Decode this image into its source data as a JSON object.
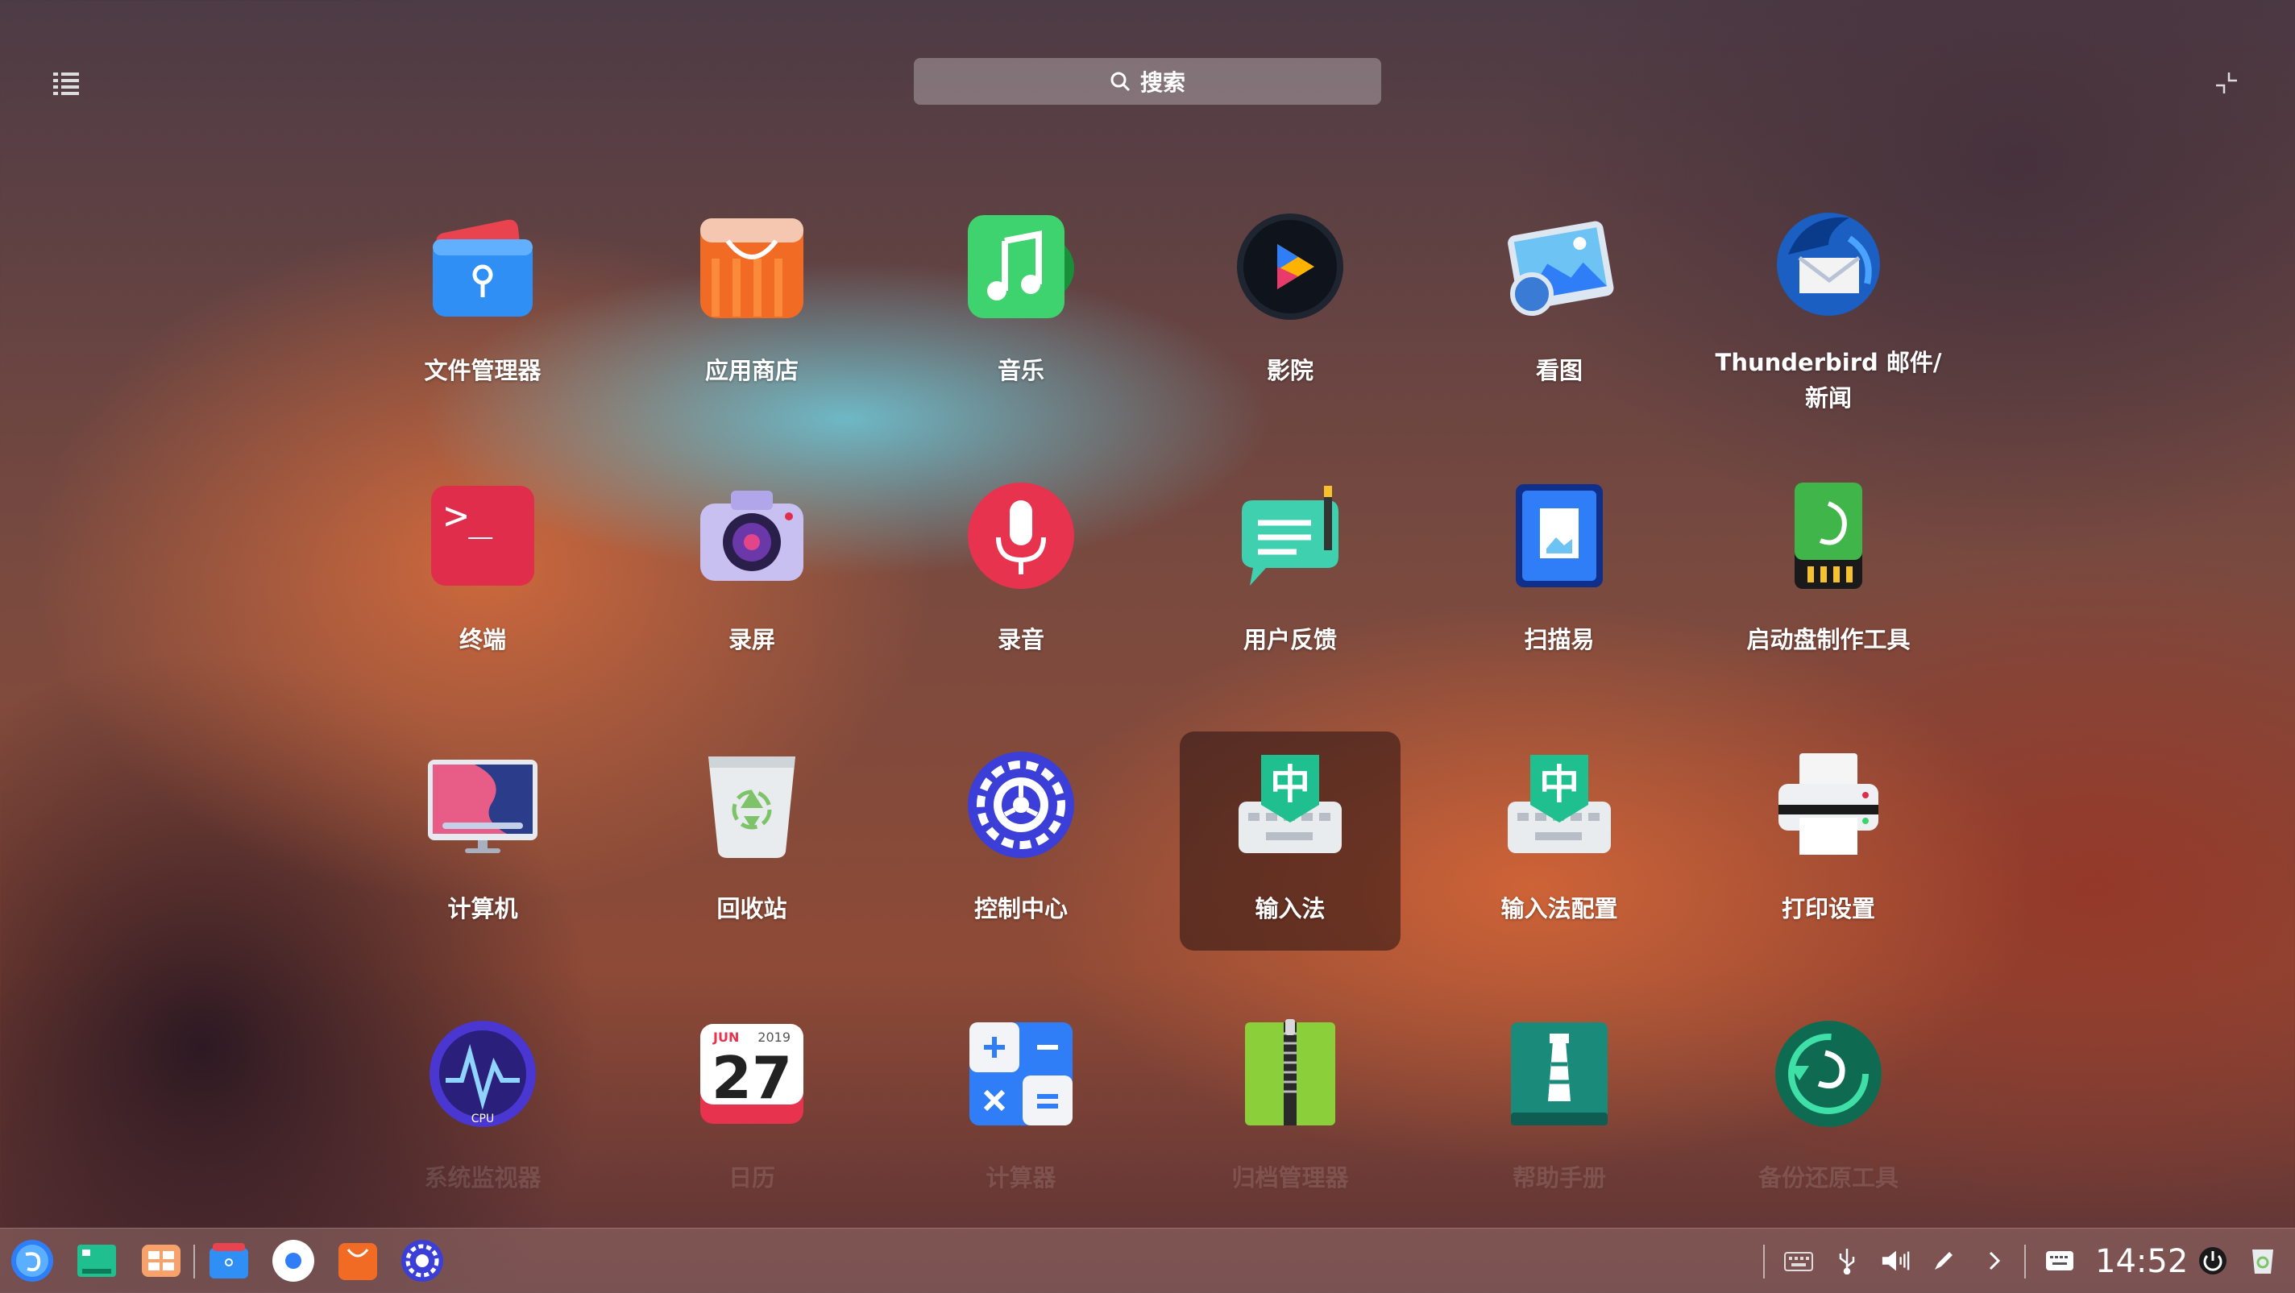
{
  "search": {
    "placeholder": "搜索"
  },
  "apps": [
    "文件管理器",
    "应用商店",
    "音乐",
    "影院",
    "看图",
    "Thunderbird 邮件/新闻",
    "终端",
    "录屏",
    "录音",
    "用户反馈",
    "扫描易",
    "启动盘制作工具",
    "计算机",
    "回收站",
    "控制中心",
    "输入法",
    "输入法配置",
    "打印设置",
    "系统监视器",
    "日历",
    "计算器",
    "归档管理器",
    "帮助手册",
    "备份还原工具"
  ],
  "calendar_icon": {
    "month": "JUN",
    "year": "2019",
    "day": "27"
  },
  "monitor_icon": {
    "text": "CPU"
  },
  "terminal_icon": {
    "prompt": ">_"
  },
  "ime_icon": {
    "glyph": "中"
  },
  "selected_app": "输入法",
  "taskbar": {
    "clock": "14:52"
  },
  "colors": {
    "selected_bg": "#3a1c1c",
    "accent": "#2f7ef7"
  }
}
